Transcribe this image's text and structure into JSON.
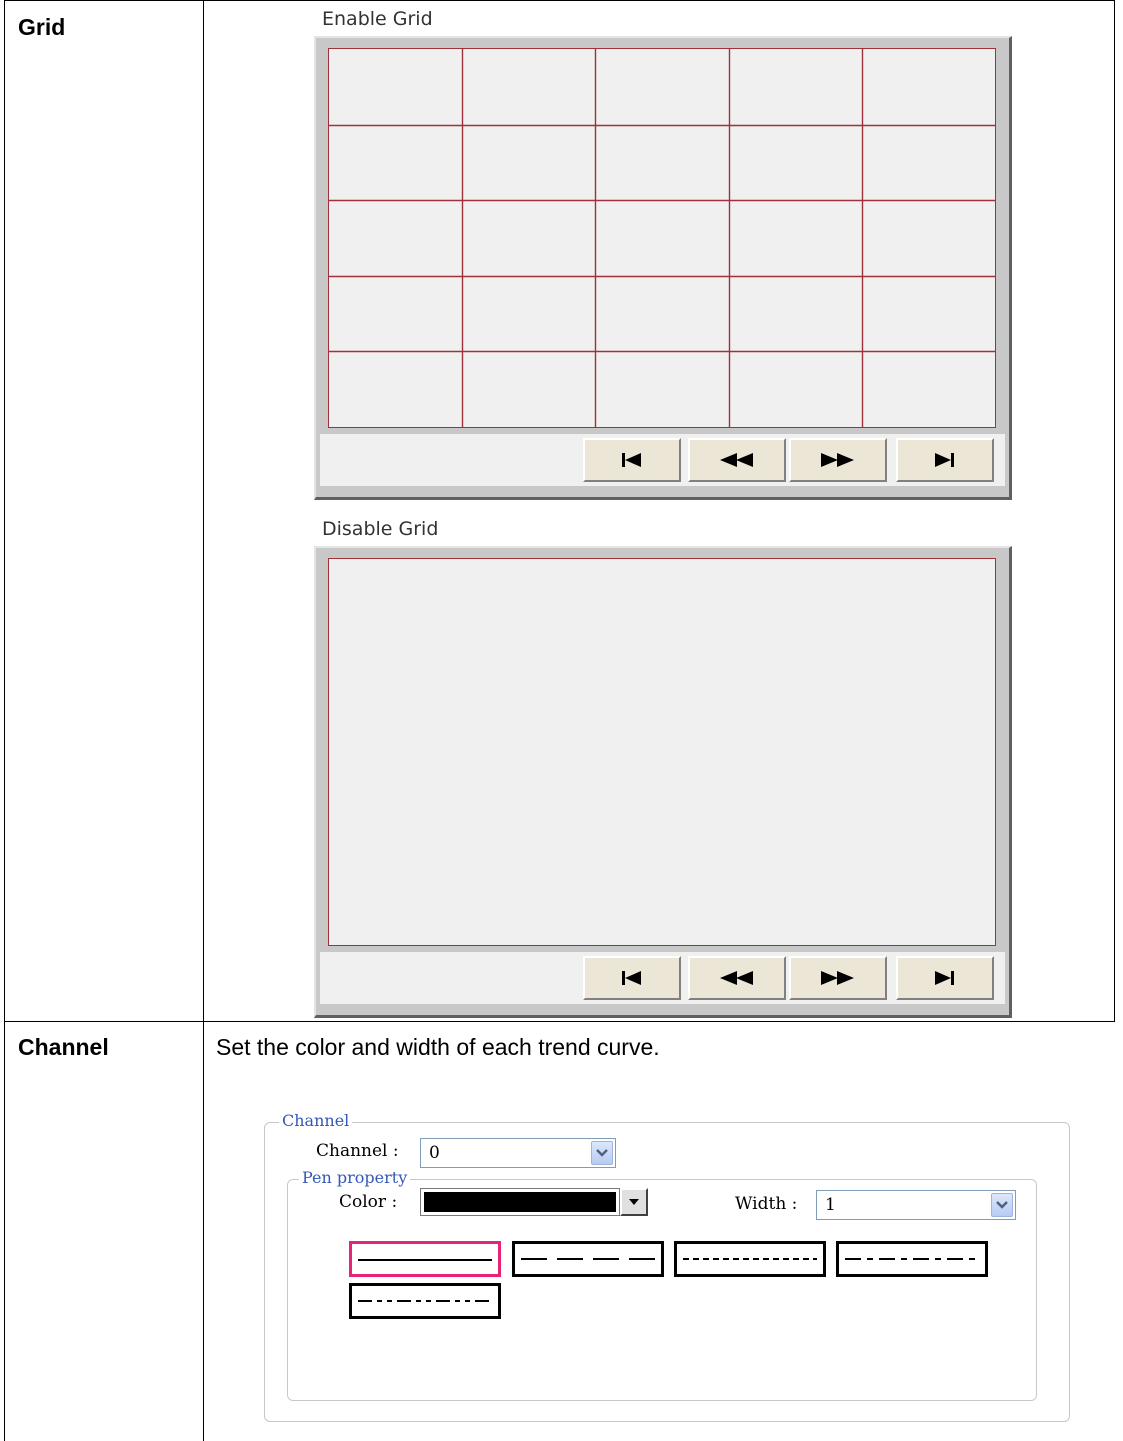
{
  "rows": [
    {
      "label": "Grid"
    },
    {
      "label": "Channel",
      "description": "Set the color and width of each trend curve."
    }
  ],
  "grid_examples": {
    "enabled": {
      "caption": "Enable Grid",
      "grid_on": true,
      "columns": 5,
      "rows": 5
    },
    "disabled": {
      "caption": "Disable Grid",
      "grid_on": false
    },
    "grid_color": "#a0303a",
    "nav_buttons": [
      "skip-to-start-icon",
      "rewind-icon",
      "fast-forward-icon",
      "skip-to-end-icon"
    ]
  },
  "channel_dialog": {
    "group_title": "Channel",
    "channel_label": "Channel :",
    "channel_value": "0",
    "pen_group_title": "Pen property",
    "color_label": "Color :",
    "color_value": "#000000",
    "width_label": "Width :",
    "width_value": "1",
    "pen_styles": [
      "solid",
      "dash",
      "dot",
      "dash-dot",
      "dash-dot-dot"
    ],
    "selected_pen_style": "solid",
    "selected_border_color": "#e6247a"
  }
}
